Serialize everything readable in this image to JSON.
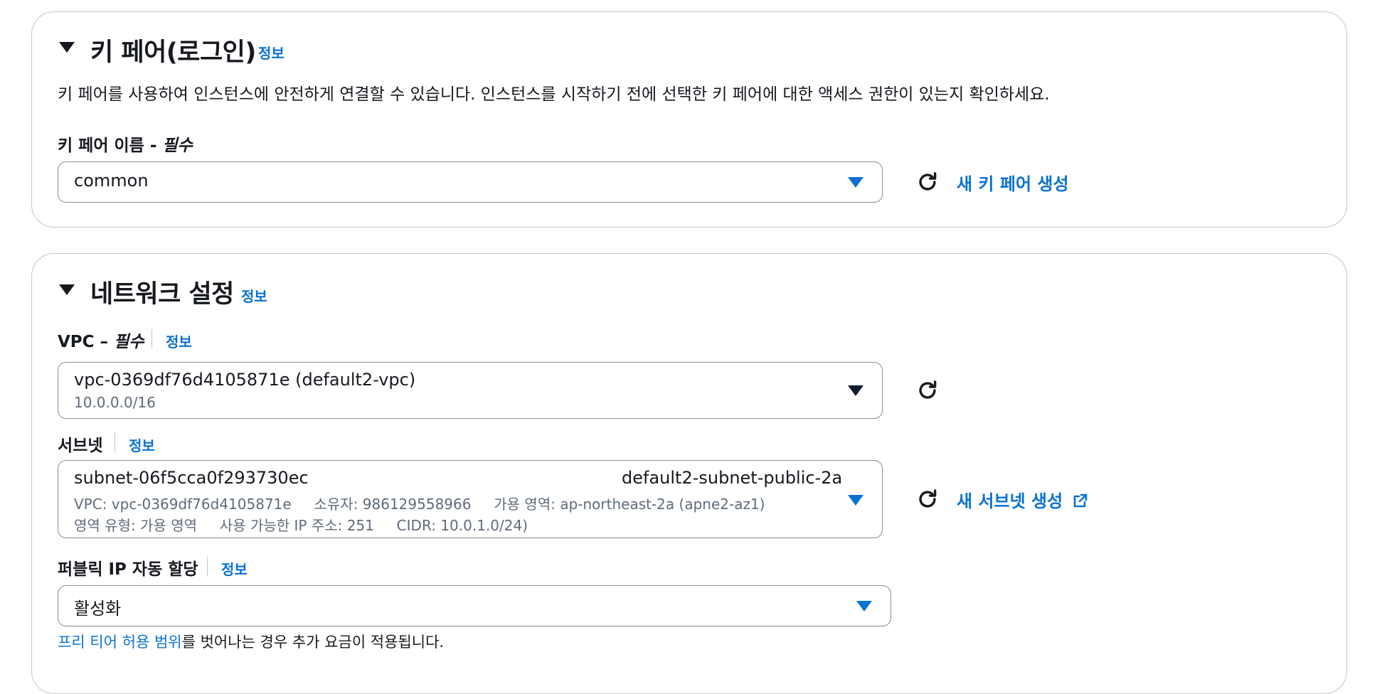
{
  "key_pair": {
    "title": "키 페어(로그인)",
    "info": "정보",
    "description": "키 페어를 사용하여 인스턴스에 안전하게 연결할 수 있습니다. 인스턴스를 시작하기 전에 선택한 키 페어에 대한 액세스 권한이 있는지 확인하세요.",
    "field_label": "키 페어 이름 - ",
    "required": "필수",
    "selected": "common",
    "create_link": "새 키 페어 생성"
  },
  "network": {
    "title": "네트워크 설정",
    "info": "정보",
    "vpc": {
      "label": "VPC – ",
      "required": "필수",
      "info": "정보",
      "selected": "vpc-0369df76d4105871e (default2-vpc)",
      "cidr": "10.0.0.0/16"
    },
    "subnet": {
      "label": "서브넷",
      "info": "정보",
      "id": "subnet-06f5cca0f293730ec",
      "name": "default2-subnet-public-2a",
      "line1": "VPC: vpc-0369df76d4105871e     소유자: 986129558966     가용 영역: ap-northeast-2a (apne2-az1)",
      "line2": "영역 유형: 가용 영역     사용 가능한 IP 주소: 251     CIDR: 10.0.1.0/24)",
      "create_link": "새 서브넷 생성"
    },
    "public_ip": {
      "label": "퍼블릭 IP 자동 할당",
      "info": "정보",
      "selected": "활성화",
      "note_link": "프리 티어 허용 범위",
      "note_text": "를 벗어나는 경우 추가 요금이 적용됩니다."
    }
  },
  "icons": [
    "caret-down-icon",
    "refresh-icon",
    "dropdown-triangle-icon",
    "external-link-icon"
  ],
  "colors": {
    "accent": "#0972d3",
    "text": "#16191f",
    "muted": "#5f6b7a",
    "border": "#8c8c94"
  }
}
